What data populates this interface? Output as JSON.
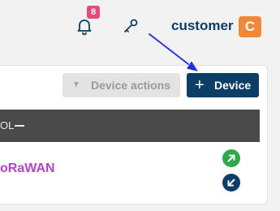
{
  "header": {
    "notifications_count": "8",
    "username": "customer",
    "avatar_initial": "C"
  },
  "toolbar": {
    "device_actions_label": "Device actions",
    "add_device_label": "Device"
  },
  "table": {
    "header_fragment": "OL",
    "row_link_text": "oRaWAN"
  },
  "colors": {
    "brand_navy": "#0c3d66",
    "avatar_orange": "#f0883a",
    "badge_pink": "#e8487c",
    "link_purple": "#b046c6",
    "uplink_green": "#2ea84a",
    "annotation_blue": "#1f2ee0"
  },
  "icons": {
    "notifications": "bell-icon",
    "key": "key-icon",
    "uplink": "arrow-up-right-icon",
    "downlink": "arrow-down-left-icon"
  }
}
